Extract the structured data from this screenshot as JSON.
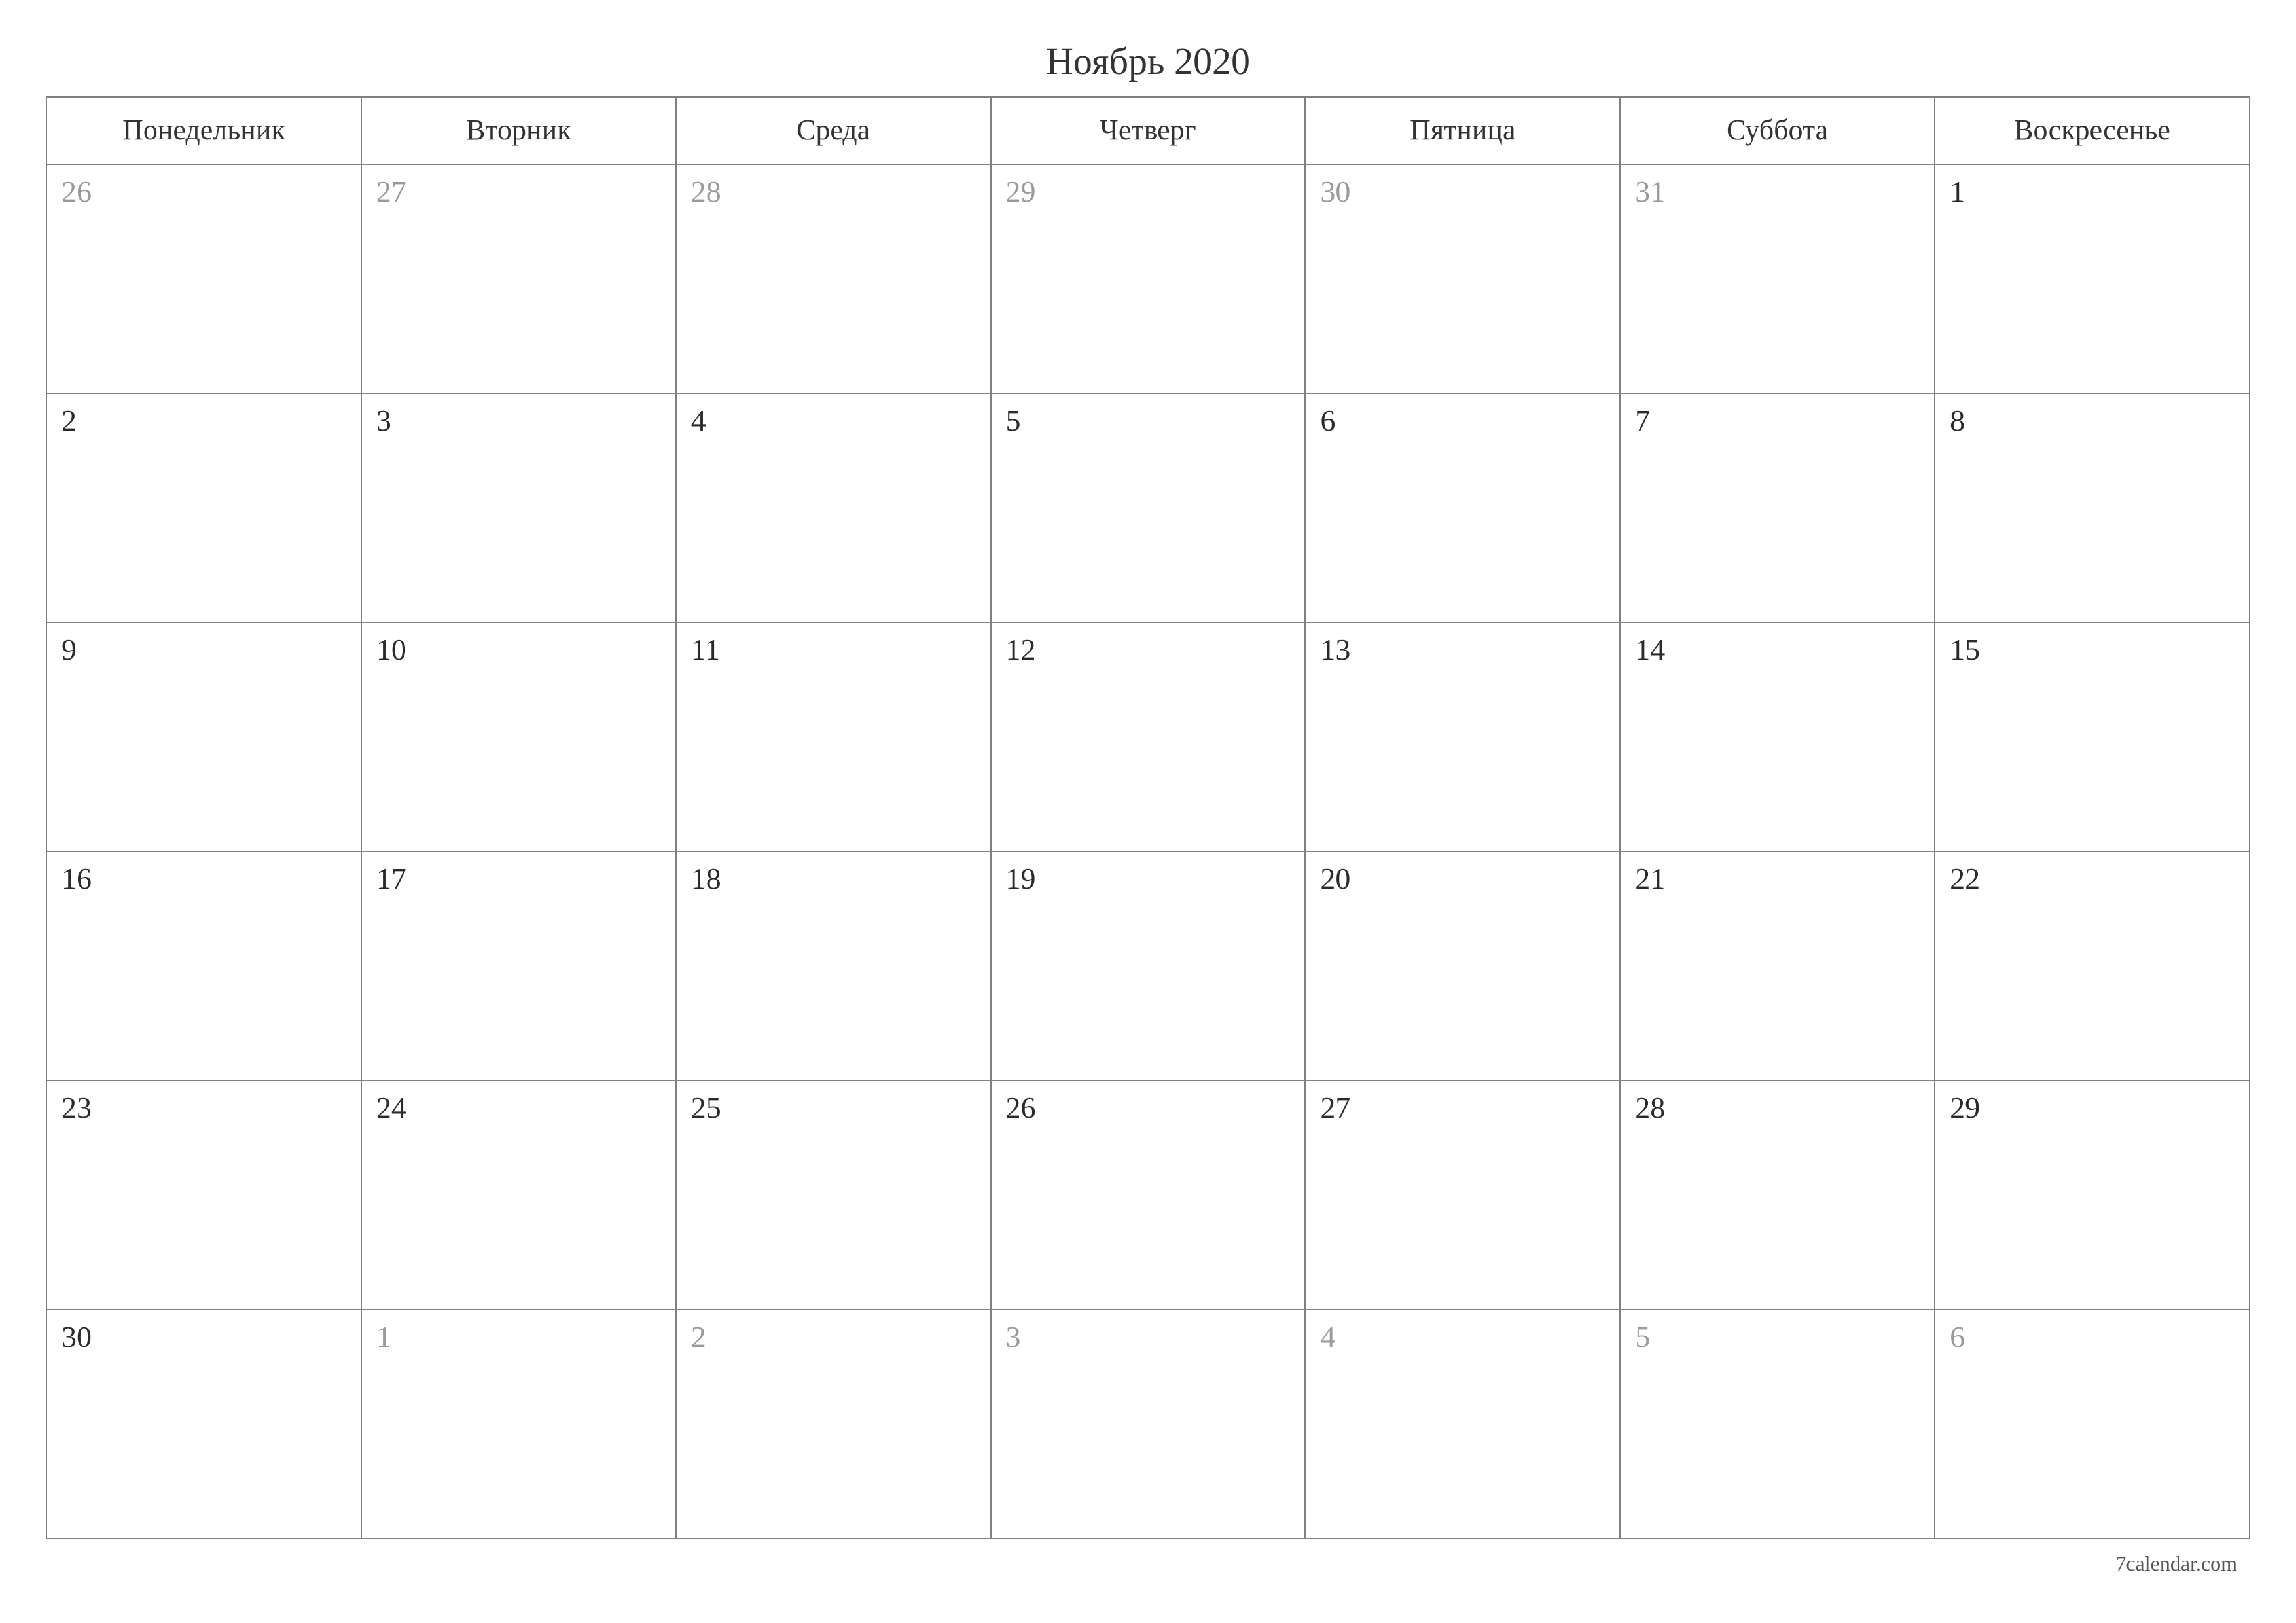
{
  "title": "Ноябрь 2020",
  "weekdays": [
    "Понедельник",
    "Вторник",
    "Среда",
    "Четверг",
    "Пятница",
    "Суббота",
    "Воскресенье"
  ],
  "weeks": [
    [
      {
        "day": "26",
        "outside": true
      },
      {
        "day": "27",
        "outside": true
      },
      {
        "day": "28",
        "outside": true
      },
      {
        "day": "29",
        "outside": true
      },
      {
        "day": "30",
        "outside": true
      },
      {
        "day": "31",
        "outside": true
      },
      {
        "day": "1",
        "outside": false
      }
    ],
    [
      {
        "day": "2",
        "outside": false
      },
      {
        "day": "3",
        "outside": false
      },
      {
        "day": "4",
        "outside": false
      },
      {
        "day": "5",
        "outside": false
      },
      {
        "day": "6",
        "outside": false
      },
      {
        "day": "7",
        "outside": false
      },
      {
        "day": "8",
        "outside": false
      }
    ],
    [
      {
        "day": "9",
        "outside": false
      },
      {
        "day": "10",
        "outside": false
      },
      {
        "day": "11",
        "outside": false
      },
      {
        "day": "12",
        "outside": false
      },
      {
        "day": "13",
        "outside": false
      },
      {
        "day": "14",
        "outside": false
      },
      {
        "day": "15",
        "outside": false
      }
    ],
    [
      {
        "day": "16",
        "outside": false
      },
      {
        "day": "17",
        "outside": false
      },
      {
        "day": "18",
        "outside": false
      },
      {
        "day": "19",
        "outside": false
      },
      {
        "day": "20",
        "outside": false
      },
      {
        "day": "21",
        "outside": false
      },
      {
        "day": "22",
        "outside": false
      }
    ],
    [
      {
        "day": "23",
        "outside": false
      },
      {
        "day": "24",
        "outside": false
      },
      {
        "day": "25",
        "outside": false
      },
      {
        "day": "26",
        "outside": false
      },
      {
        "day": "27",
        "outside": false
      },
      {
        "day": "28",
        "outside": false
      },
      {
        "day": "29",
        "outside": false
      }
    ],
    [
      {
        "day": "30",
        "outside": false
      },
      {
        "day": "1",
        "outside": true
      },
      {
        "day": "2",
        "outside": true
      },
      {
        "day": "3",
        "outside": true
      },
      {
        "day": "4",
        "outside": true
      },
      {
        "day": "5",
        "outside": true
      },
      {
        "day": "6",
        "outside": true
      }
    ]
  ],
  "footer": "7calendar.com"
}
